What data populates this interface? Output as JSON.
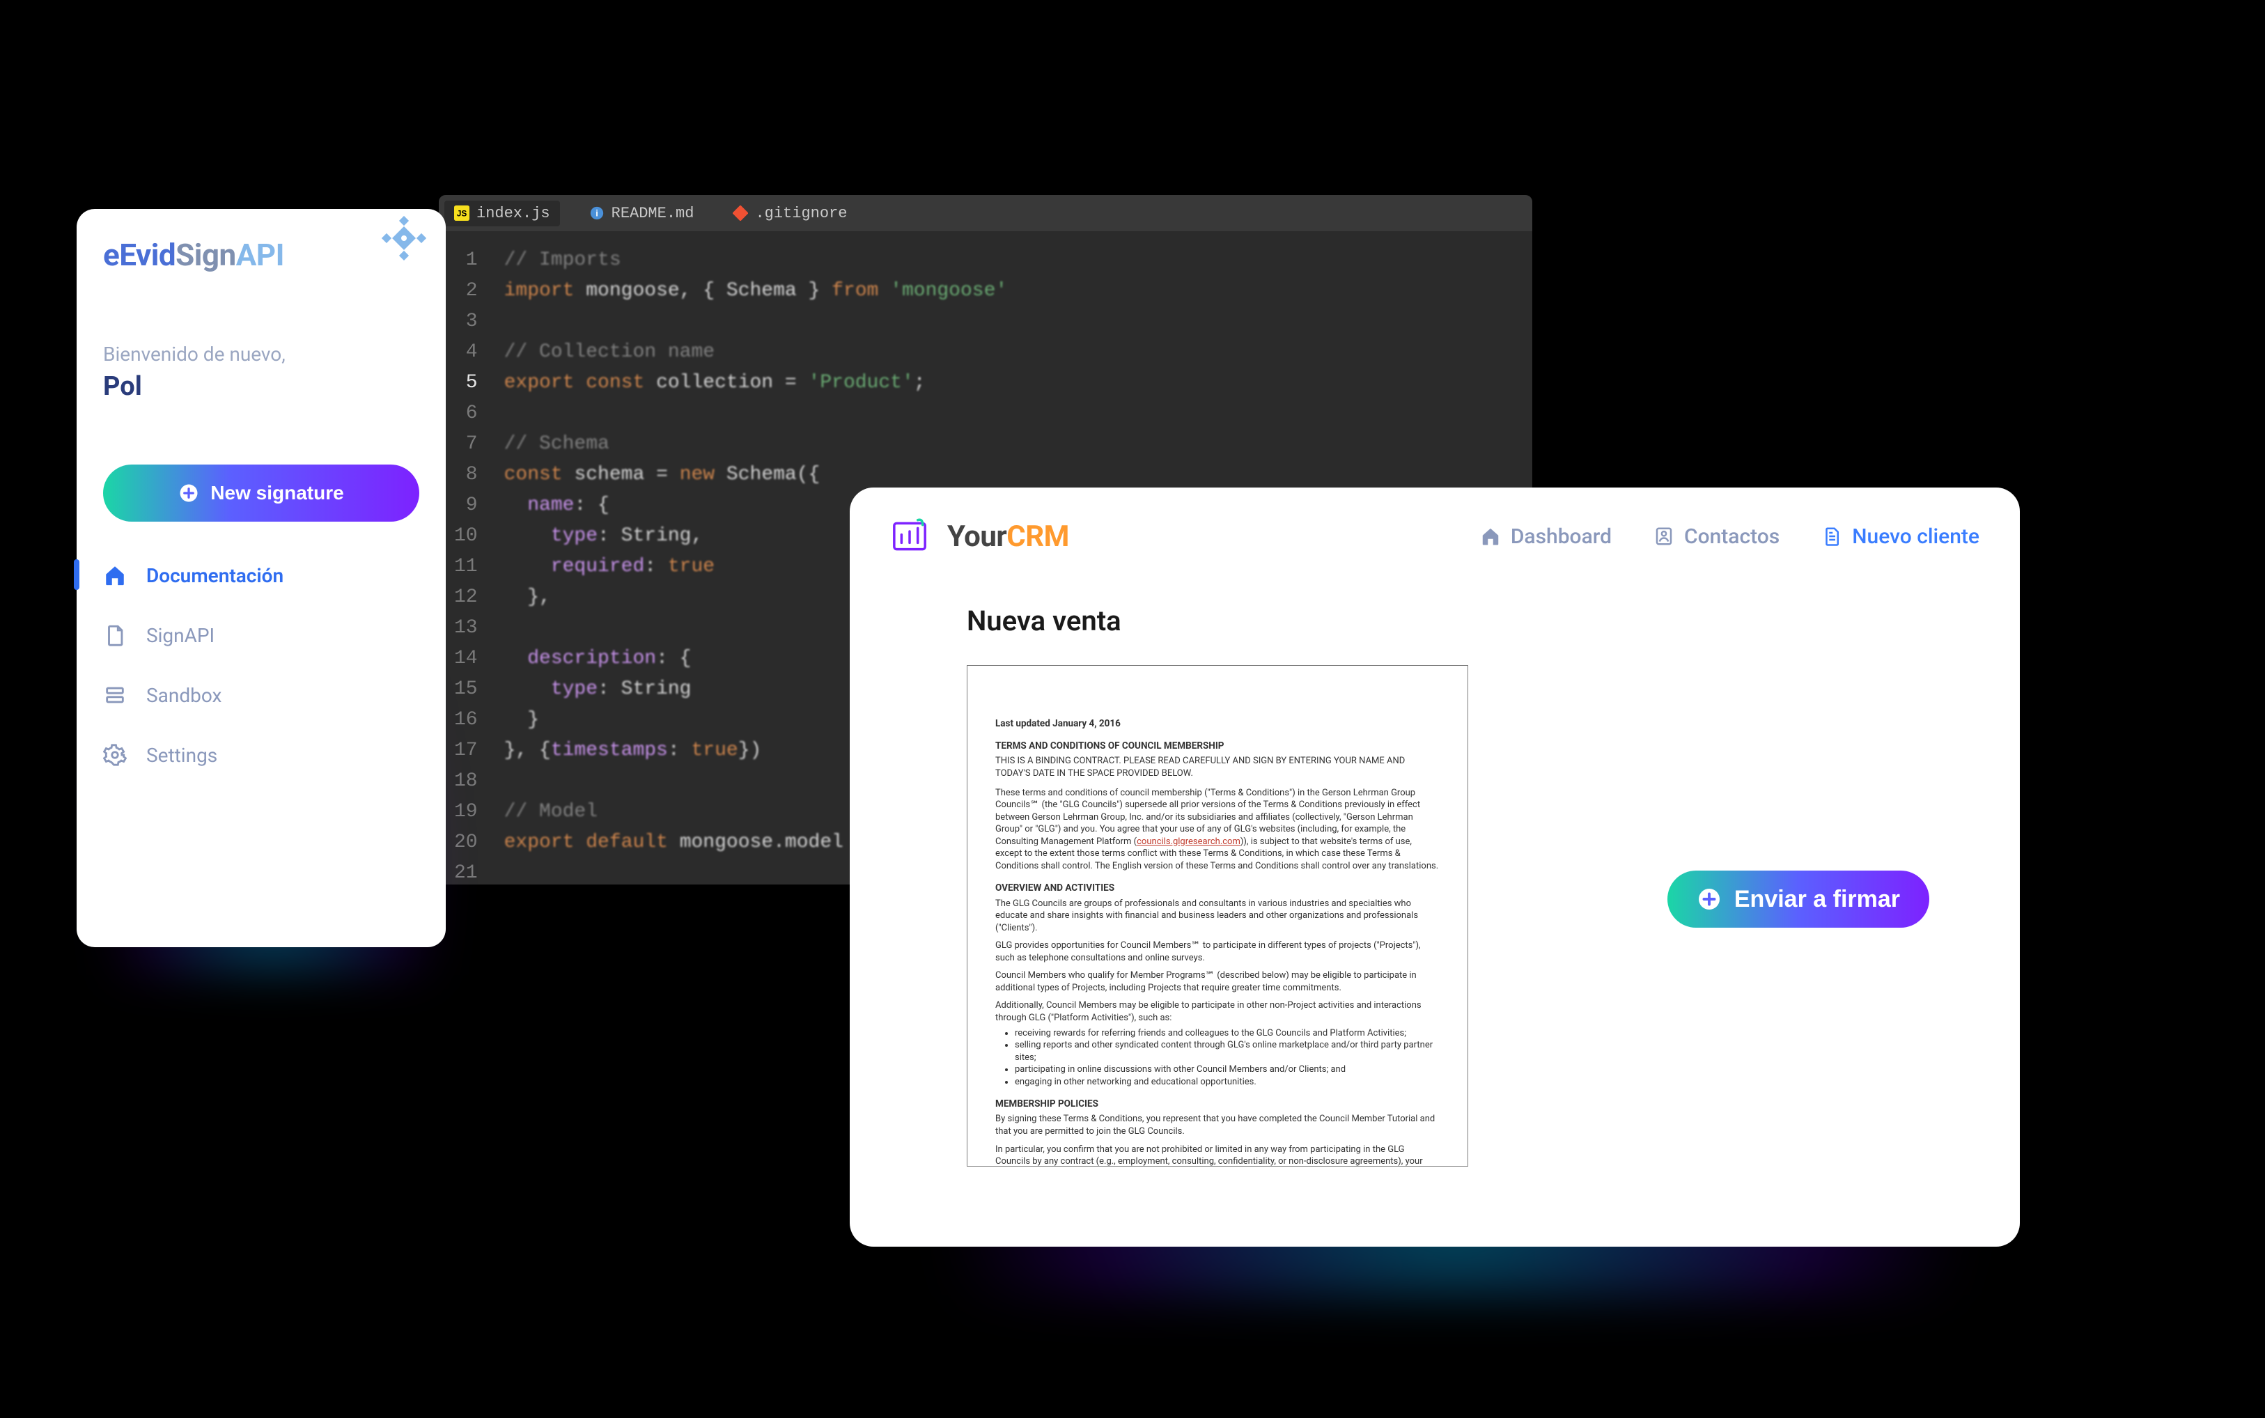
{
  "editor": {
    "tabs": [
      {
        "label": "index.js",
        "icon": "js-file-icon",
        "active": true
      },
      {
        "label": "README.md",
        "icon": "info-file-icon",
        "active": false
      },
      {
        "label": ".gitignore",
        "icon": "git-file-icon",
        "active": false
      }
    ],
    "line_numbers": [
      "1",
      "2",
      "3",
      "4",
      "5",
      "6",
      "7",
      "8",
      "9",
      "10",
      "11",
      "12",
      "13",
      "14",
      "15",
      "16",
      "17",
      "18",
      "19",
      "20",
      "21"
    ],
    "active_line": 5,
    "code_lines": [
      {
        "n": 1,
        "tokens": [
          [
            "comment",
            "// Imports"
          ]
        ]
      },
      {
        "n": 2,
        "tokens": [
          [
            "keyword",
            "import"
          ],
          [
            "plain",
            " "
          ],
          [
            "ident",
            "mongoose"
          ],
          [
            "punct",
            ", { "
          ],
          [
            "ident",
            "Schema"
          ],
          [
            "punct",
            " } "
          ],
          [
            "keyword",
            "from"
          ],
          [
            "plain",
            " "
          ],
          [
            "string",
            "'mongoose'"
          ]
        ]
      },
      {
        "n": 3,
        "tokens": []
      },
      {
        "n": 4,
        "tokens": [
          [
            "comment",
            "// Collection name"
          ]
        ]
      },
      {
        "n": 5,
        "tokens": [
          [
            "keyword",
            "export"
          ],
          [
            "plain",
            " "
          ],
          [
            "keyword",
            "const"
          ],
          [
            "plain",
            " "
          ],
          [
            "ident",
            "collection"
          ],
          [
            "punct",
            " = "
          ],
          [
            "string",
            "'Product'"
          ],
          [
            "punct",
            ";"
          ]
        ]
      },
      {
        "n": 6,
        "tokens": []
      },
      {
        "n": 7,
        "tokens": [
          [
            "comment",
            "// Schema"
          ]
        ]
      },
      {
        "n": 8,
        "tokens": [
          [
            "keyword",
            "const"
          ],
          [
            "plain",
            " "
          ],
          [
            "ident",
            "schema"
          ],
          [
            "punct",
            " = "
          ],
          [
            "keyword",
            "new"
          ],
          [
            "plain",
            " "
          ],
          [
            "ident",
            "Schema"
          ],
          [
            "punct",
            "({"
          ]
        ]
      },
      {
        "n": 9,
        "tokens": [
          [
            "plain",
            "  "
          ],
          [
            "prop",
            "name"
          ],
          [
            "punct",
            ": {"
          ]
        ]
      },
      {
        "n": 10,
        "tokens": [
          [
            "plain",
            "    "
          ],
          [
            "prop",
            "type"
          ],
          [
            "punct",
            ": "
          ],
          [
            "ident",
            "String"
          ],
          [
            "punct",
            ","
          ]
        ]
      },
      {
        "n": 11,
        "tokens": [
          [
            "plain",
            "    "
          ],
          [
            "prop",
            "required"
          ],
          [
            "punct",
            ": "
          ],
          [
            "const",
            "true"
          ]
        ]
      },
      {
        "n": 12,
        "tokens": [
          [
            "plain",
            "  "
          ],
          [
            "punct",
            "},"
          ]
        ]
      },
      {
        "n": 13,
        "tokens": []
      },
      {
        "n": 14,
        "tokens": [
          [
            "plain",
            "  "
          ],
          [
            "prop",
            "description"
          ],
          [
            "punct",
            ": {"
          ]
        ]
      },
      {
        "n": 15,
        "tokens": [
          [
            "plain",
            "    "
          ],
          [
            "prop",
            "type"
          ],
          [
            "punct",
            ": "
          ],
          [
            "ident",
            "String"
          ]
        ]
      },
      {
        "n": 16,
        "tokens": [
          [
            "plain",
            "  "
          ],
          [
            "punct",
            "}"
          ]
        ]
      },
      {
        "n": 17,
        "tokens": [
          [
            "punct",
            "}, {"
          ],
          [
            "prop",
            "timestamps"
          ],
          [
            "punct",
            ": "
          ],
          [
            "const",
            "true"
          ],
          [
            "punct",
            "})"
          ]
        ]
      },
      {
        "n": 18,
        "tokens": []
      },
      {
        "n": 19,
        "tokens": [
          [
            "comment",
            "// Model"
          ]
        ]
      },
      {
        "n": 20,
        "tokens": [
          [
            "keyword",
            "export"
          ],
          [
            "plain",
            " "
          ],
          [
            "keyword",
            "default"
          ],
          [
            "plain",
            " "
          ],
          [
            "ident",
            "mongoose"
          ],
          [
            "punct",
            "."
          ],
          [
            "ident",
            "model"
          ],
          [
            "plain",
            "  "
          ]
        ]
      },
      {
        "n": 21,
        "tokens": []
      }
    ]
  },
  "sidebar": {
    "brand": {
      "part1": "eEvid",
      "part2": "Sign",
      "part3": "API"
    },
    "welcome_label": "Bienvenido de nuevo,",
    "username": "Pol",
    "new_signature_label": "New signature",
    "items": [
      {
        "label": "Documentación",
        "icon": "home-icon",
        "active": true
      },
      {
        "label": "SignAPI",
        "icon": "document-icon",
        "active": false
      },
      {
        "label": "Sandbox",
        "icon": "layers-icon",
        "active": false
      },
      {
        "label": "Settings",
        "icon": "gear-icon",
        "active": false
      }
    ]
  },
  "crm": {
    "brand": {
      "part1": "Your",
      "part2": "CRM"
    },
    "nav": [
      {
        "label": "Dashboard",
        "icon": "home-icon",
        "active": false
      },
      {
        "label": "Contactos",
        "icon": "users-icon",
        "active": false
      },
      {
        "label": "Nuevo cliente",
        "icon": "file-icon",
        "active": true
      }
    ],
    "heading": "Nueva venta",
    "send_button_label": "Enviar a firmar",
    "document": {
      "updated": "Last updated January 4, 2016",
      "title": "TERMS AND CONDITIONS OF COUNCIL MEMBERSHIP",
      "intro": "THIS IS A BINDING CONTRACT.  PLEASE READ CAREFULLY AND SIGN BY ENTERING YOUR NAME AND TODAY'S DATE IN THE SPACE PROVIDED BELOW.",
      "para_terms": "These terms and conditions of council membership (\"Terms & Conditions\") in the Gerson Lehrman Group Councils℠ (the \"GLG Councils\") supersede all prior versions of the Terms & Conditions previously in effect between Gerson Lehrman Group, Inc. and/or its subsidiaries and affiliates (collectively, \"Gerson Lehrman Group\" or \"GLG\") and you.  You agree that your use of any of GLG's websites (including, for example, the Consulting Management Platform (councils.glgresearch.com)), is subject to that website's terms of use, except to the extent  those terms conflict with these Terms & Conditions, in which case these Terms & Conditions shall control. The English version of these Terms and Conditions shall control over any translations.",
      "h_overview": "OVERVIEW AND ACTIVITIES",
      "overview_p1": "The GLG Councils are groups of professionals and consultants in various industries and specialties who educate and share insights with financial and business leaders and other organizations and professionals (\"Clients\").",
      "overview_p2": "GLG provides opportunities for Council Members℠ to participate in different types of projects (\"Projects\"), such as telephone consultations and online surveys.",
      "overview_p3": "Council Members who qualify for Member Programs℠ (described below) may be eligible to participate in additional types of Projects, including Projects that require greater time commitments.",
      "overview_p4": "Additionally, Council Members may be eligible to participate in other non-Project activities and interactions through GLG (\"Platform Activities\"), such as:",
      "bullets": [
        "receiving rewards for referring friends and colleagues to the GLG Councils and Platform Activities;",
        "selling reports and other syndicated content through GLG's online marketplace and/or third party partner sites;",
        "participating in online discussions with other Council Members and/or Clients; and",
        "engaging in other networking and educational opportunities."
      ],
      "h_policies": "MEMBERSHIP POLICIES",
      "policies_p1": "By signing these Terms & Conditions, you represent that you have completed the Council Member Tutorial and that you are permitted to join the GLG Councils.",
      "policies_p2": "In particular, you confirm that you are not prohibited or limited in any way from participating in the GLG Councils by any contract (e.g., employment, consulting, confidentiality, or non-disclosure agreements), your current employer's policies or codes of conduct if you are employed, or any similar policies or obligations that limit your conduct in any way. Further, to the extent your ability to consult is limited in any way, you confirm that you have obtained all necessary consents or"
    }
  }
}
